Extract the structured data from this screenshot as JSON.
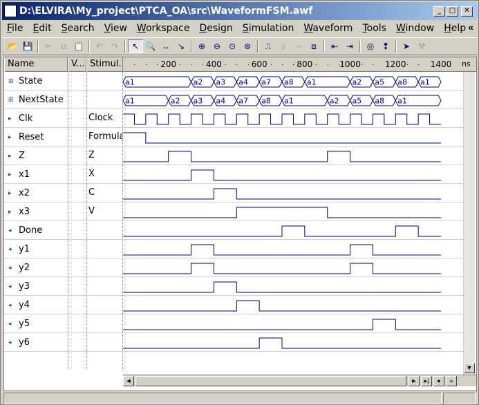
{
  "window": {
    "title": "D:\\ELVIRA\\My_project\\PTCA_OA\\src\\WaveformFSM.awf"
  },
  "menu": [
    {
      "label": "File"
    },
    {
      "label": "Edit"
    },
    {
      "label": "Search"
    },
    {
      "label": "View"
    },
    {
      "label": "Workspace"
    },
    {
      "label": "Design"
    },
    {
      "label": "Simulation"
    },
    {
      "label": "Waveform"
    },
    {
      "label": "Tools"
    },
    {
      "label": "Window"
    },
    {
      "label": "Help"
    }
  ],
  "menu_overflow": "«",
  "toolbar": [
    {
      "icon": "open-folder-icon",
      "enabled": true
    },
    {
      "icon": "save-icon",
      "enabled": true
    },
    {
      "sep": true
    },
    {
      "icon": "cut-icon",
      "enabled": false
    },
    {
      "icon": "copy-icon",
      "enabled": false
    },
    {
      "icon": "paste-icon",
      "enabled": false
    },
    {
      "sep": true
    },
    {
      "icon": "undo-icon",
      "enabled": false
    },
    {
      "icon": "redo-icon",
      "enabled": false
    },
    {
      "sep": true
    },
    {
      "icon": "select-pointer-icon",
      "enabled": true,
      "pressed": true
    },
    {
      "icon": "zoom-tool-icon",
      "enabled": true
    },
    {
      "icon": "measure-tool-icon",
      "enabled": true
    },
    {
      "icon": "edit-pointer-icon",
      "enabled": true
    },
    {
      "sep": true
    },
    {
      "icon": "zoom-in-icon",
      "enabled": true
    },
    {
      "icon": "zoom-out-icon",
      "enabled": true
    },
    {
      "icon": "zoom-fit-icon",
      "enabled": true
    },
    {
      "icon": "zoom-range-icon",
      "enabled": true
    },
    {
      "sep": true
    },
    {
      "icon": "add-signal-icon",
      "enabled": true
    },
    {
      "icon": "delete-signal-icon",
      "enabled": false
    },
    {
      "icon": "stimulator-icon",
      "enabled": false
    },
    {
      "icon": "compare-icon",
      "enabled": true
    },
    {
      "sep": true
    },
    {
      "icon": "prev-edge-icon",
      "enabled": true
    },
    {
      "icon": "next-edge-icon",
      "enabled": true
    },
    {
      "sep": true
    },
    {
      "icon": "find-binoculars-icon",
      "enabled": true
    },
    {
      "icon": "bookmark-icon",
      "enabled": true
    },
    {
      "sep": true
    },
    {
      "icon": "pin-marker-icon",
      "enabled": true
    },
    {
      "icon": "settings-wrench-icon",
      "enabled": false
    }
  ],
  "columns": {
    "name": "Name",
    "value": "V...",
    "stimulator": "Stimul..."
  },
  "ruler": {
    "unit": "ns",
    "ticks": [
      {
        "t": 200,
        "label": "200"
      },
      {
        "t": 400,
        "label": "400"
      },
      {
        "t": 600,
        "label": "600"
      },
      {
        "t": 800,
        "label": "800"
      },
      {
        "t": 1000,
        "label": "1000"
      },
      {
        "t": 1200,
        "label": "1200"
      },
      {
        "t": 1400,
        "label": "1400"
      }
    ],
    "t_end": 1400
  },
  "colors": {
    "wave": "#000080",
    "grid": "#808080"
  },
  "signals": [
    {
      "name": "State",
      "kind": "vector",
      "stimulator": "",
      "segments": [
        {
          "t0": 0,
          "t1": 300,
          "v": "a1"
        },
        {
          "t0": 300,
          "t1": 400,
          "v": "a2"
        },
        {
          "t0": 400,
          "t1": 500,
          "v": "a3"
        },
        {
          "t0": 500,
          "t1": 600,
          "v": "a4"
        },
        {
          "t0": 600,
          "t1": 700,
          "v": "a7"
        },
        {
          "t0": 700,
          "t1": 800,
          "v": "a8"
        },
        {
          "t0": 800,
          "t1": 1000,
          "v": "a1"
        },
        {
          "t0": 1000,
          "t1": 1100,
          "v": "a2"
        },
        {
          "t0": 1100,
          "t1": 1200,
          "v": "a5"
        },
        {
          "t0": 1200,
          "t1": 1300,
          "v": "a8"
        },
        {
          "t0": 1300,
          "t1": 1400,
          "v": "a1"
        }
      ]
    },
    {
      "name": "NextState",
      "kind": "vector",
      "stimulator": "",
      "segments": [
        {
          "t0": 0,
          "t1": 200,
          "v": "a1"
        },
        {
          "t0": 200,
          "t1": 300,
          "v": "a2"
        },
        {
          "t0": 300,
          "t1": 400,
          "v": "a3"
        },
        {
          "t0": 400,
          "t1": 500,
          "v": "a4"
        },
        {
          "t0": 500,
          "t1": 600,
          "v": "a7"
        },
        {
          "t0": 600,
          "t1": 700,
          "v": "a8"
        },
        {
          "t0": 700,
          "t1": 900,
          "v": "a1"
        },
        {
          "t0": 900,
          "t1": 1000,
          "v": "a2"
        },
        {
          "t0": 1000,
          "t1": 1100,
          "v": "a5"
        },
        {
          "t0": 1100,
          "t1": 1200,
          "v": "a8"
        },
        {
          "t0": 1200,
          "t1": 1400,
          "v": "a1"
        }
      ]
    },
    {
      "name": "Clk",
      "kind": "input",
      "stimulator": "Clock",
      "clock": {
        "period": 100,
        "high_first": true
      }
    },
    {
      "name": "Reset",
      "kind": "input",
      "stimulator": "Formula",
      "init": 1,
      "edges": [
        100
      ]
    },
    {
      "name": "Z",
      "kind": "input",
      "stimulator": "Z",
      "init": 0,
      "edges": [
        200,
        300,
        900,
        1000
      ]
    },
    {
      "name": "x1",
      "kind": "input",
      "stimulator": "X",
      "init": 0,
      "edges": [
        300,
        400
      ]
    },
    {
      "name": "x2",
      "kind": "input",
      "stimulator": "C",
      "init": 0,
      "edges": [
        400,
        500
      ]
    },
    {
      "name": "x3",
      "kind": "input",
      "stimulator": "V",
      "init": 0,
      "edges": [
        500,
        900
      ]
    },
    {
      "name": "Done",
      "kind": "output",
      "stimulator": "",
      "init": 0,
      "edges": [
        700,
        800,
        1200,
        1300
      ]
    },
    {
      "name": "y1",
      "kind": "output",
      "stimulator": "",
      "init": 0,
      "edges": [
        300,
        400,
        1000,
        1100
      ]
    },
    {
      "name": "y2",
      "kind": "output",
      "stimulator": "",
      "init": 0,
      "edges": [
        300,
        400,
        1000,
        1100
      ]
    },
    {
      "name": "y3",
      "kind": "output",
      "stimulator": "",
      "init": 0,
      "edges": [
        400,
        500
      ]
    },
    {
      "name": "y4",
      "kind": "output",
      "stimulator": "",
      "init": 0,
      "edges": [
        500,
        600
      ]
    },
    {
      "name": "y5",
      "kind": "output",
      "stimulator": "",
      "init": 0,
      "edges": [
        1100,
        1200
      ]
    },
    {
      "name": "y6",
      "kind": "output",
      "stimulator": "",
      "init": 0,
      "edges": [
        600,
        700
      ]
    }
  ]
}
